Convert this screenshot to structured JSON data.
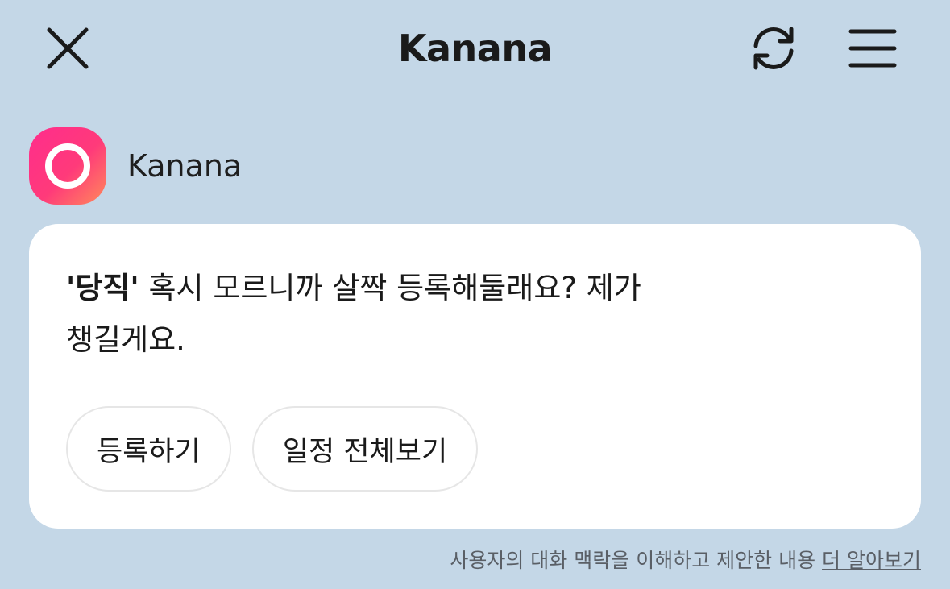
{
  "header": {
    "title": "Kanana",
    "close_icon": "close-icon",
    "refresh_icon": "refresh-icon",
    "menu_icon": "menu-icon"
  },
  "bot": {
    "name": "Kanana",
    "avatar_colors": [
      "#ff2d8c",
      "#ff8a5a"
    ]
  },
  "message": {
    "highlight": "'당직'",
    "line1_rest": " 혹시 모르니까 살짝 등록해둘래요? 제가",
    "line2": "챙길게요."
  },
  "actions": [
    {
      "label": "등록하기"
    },
    {
      "label": "일정 전체보기"
    }
  ],
  "footnote": {
    "text": "사용자의 대화 맥락을 이해하고 제안한 내용 ",
    "link": "더 알아보기"
  },
  "colors": {
    "background": "#c4d7e7",
    "card": "#ffffff",
    "text": "#1a1a1a",
    "muted": "#5a5f66"
  }
}
